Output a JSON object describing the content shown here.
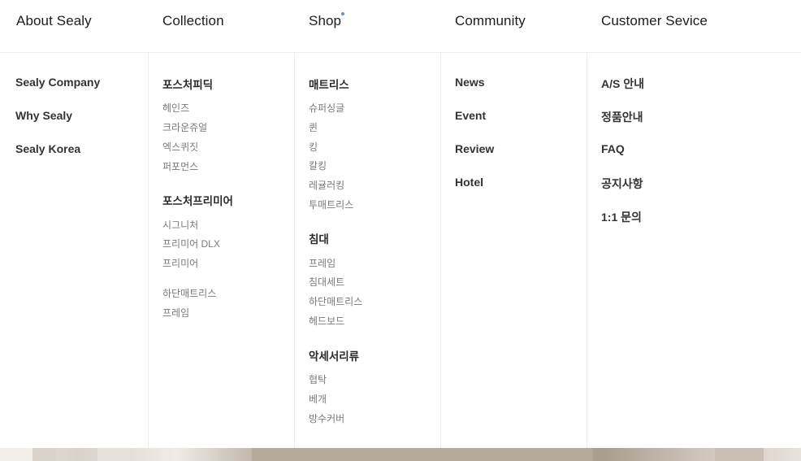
{
  "nav": {
    "about": "About Sealy",
    "collection": "Collection",
    "shop": "Shop",
    "community": "Community",
    "customer": "Customer Sevice"
  },
  "about_links": [
    "Sealy Company",
    "Why Sealy",
    "Sealy Korea"
  ],
  "collection": {
    "group1_title": "포스처피딕",
    "group1_items": [
      "헤인즈",
      "크라운쥬얼",
      "엑스퀴짓",
      "퍼포먼스"
    ],
    "group2_title": "포스처프리미어",
    "group2_items": [
      "시그니처",
      "프리미어 DLX",
      "프리미어"
    ],
    "extra_items": [
      "하단매트리스",
      "프레임"
    ]
  },
  "shop": {
    "mattress_title": "매트리스",
    "mattress_items": [
      "슈퍼싱글",
      "퀸",
      "킹",
      "칼킹",
      "레귤러킹",
      "투매트리스"
    ],
    "bed_title": "침대",
    "bed_items": [
      "프레임",
      "침대세트",
      "하단매트리스",
      "헤드보드"
    ],
    "acc_title": "악세서리류",
    "acc_items": [
      "협탁",
      "베개",
      "방수커버"
    ]
  },
  "community_links": [
    "News",
    "Event",
    "Review",
    "Hotel"
  ],
  "customer_links": [
    "A/S 안내",
    "정품안내",
    "FAQ",
    "공지사항",
    "1:1 문의"
  ],
  "colors": {
    "accent_dot": "#6b8fd6",
    "divider": "#ececec"
  }
}
